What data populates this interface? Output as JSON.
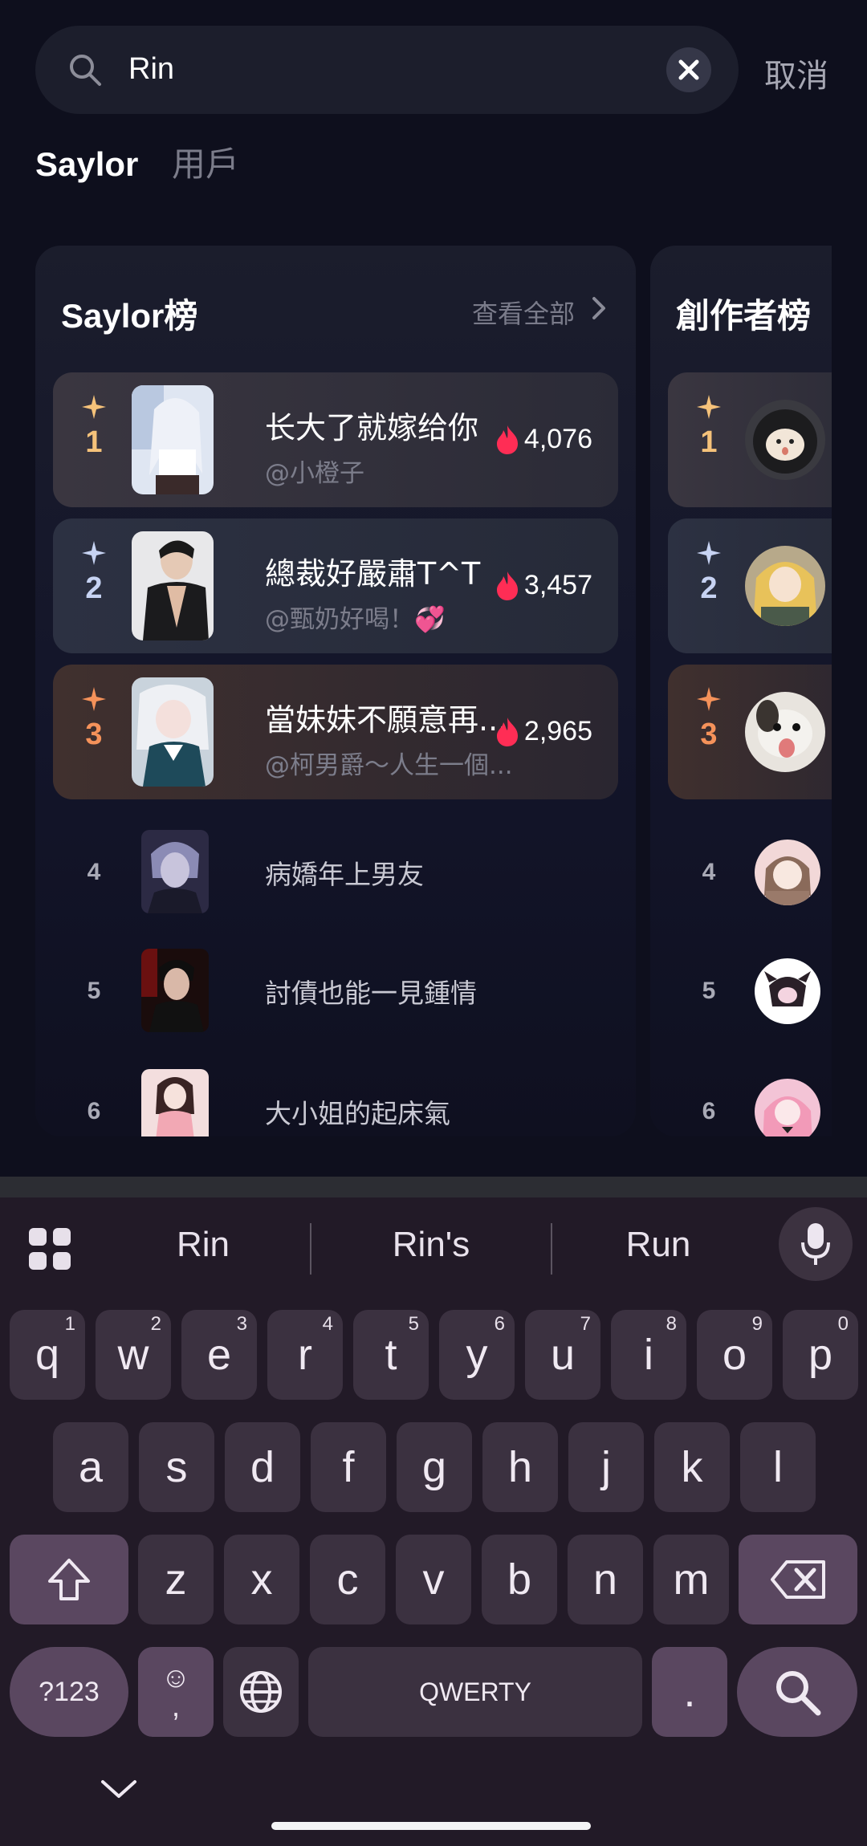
{
  "search": {
    "query": "Rin",
    "cancel_label": "取消"
  },
  "tabs": [
    {
      "label": "Saylor",
      "active": true
    },
    {
      "label": "用戶",
      "active": false
    }
  ],
  "saylor_board": {
    "title": "Saylor榜",
    "see_all": "查看全部",
    "top": [
      {
        "rank": "1",
        "title": "长大了就嫁给你",
        "author": "@小橙子",
        "count": "4,076"
      },
      {
        "rank": "2",
        "title": "總裁好嚴肅T^T",
        "author": "@甄奶好喝！💞",
        "count": "3,457"
      },
      {
        "rank": "3",
        "title": "當妹妹不願意再...",
        "author": "@柯男爵～人生一個...",
        "count": "2,965"
      }
    ],
    "rest": [
      {
        "rank": "4",
        "title": "病嬌年上男友"
      },
      {
        "rank": "5",
        "title": "討債也能一見鍾情"
      },
      {
        "rank": "6",
        "title": "大小姐的起床氣"
      }
    ]
  },
  "creator_board": {
    "title": "創作者榜",
    "ranks": [
      "1",
      "2",
      "3",
      "4",
      "5",
      "6"
    ]
  },
  "colors": {
    "gold": "#f5c27a",
    "silver": "#c7d3f3",
    "bronze": "#f5925a",
    "flame": "#ff2d55"
  },
  "keyboard": {
    "suggestions": [
      "Rin",
      "Rin's",
      "Run"
    ],
    "row1": [
      {
        "k": "q",
        "h": "1"
      },
      {
        "k": "w",
        "h": "2"
      },
      {
        "k": "e",
        "h": "3"
      },
      {
        "k": "r",
        "h": "4"
      },
      {
        "k": "t",
        "h": "5"
      },
      {
        "k": "y",
        "h": "6"
      },
      {
        "k": "u",
        "h": "7"
      },
      {
        "k": "i",
        "h": "8"
      },
      {
        "k": "o",
        "h": "9"
      },
      {
        "k": "p",
        "h": "0"
      }
    ],
    "row2": [
      "a",
      "s",
      "d",
      "f",
      "g",
      "h",
      "j",
      "k",
      "l"
    ],
    "row3": [
      "z",
      "x",
      "c",
      "v",
      "b",
      "n",
      "m"
    ],
    "symbols_label": "?123",
    "emoji_label": "☺",
    "comma_label": ",",
    "space_label": "QWERTY",
    "period_label": "."
  }
}
